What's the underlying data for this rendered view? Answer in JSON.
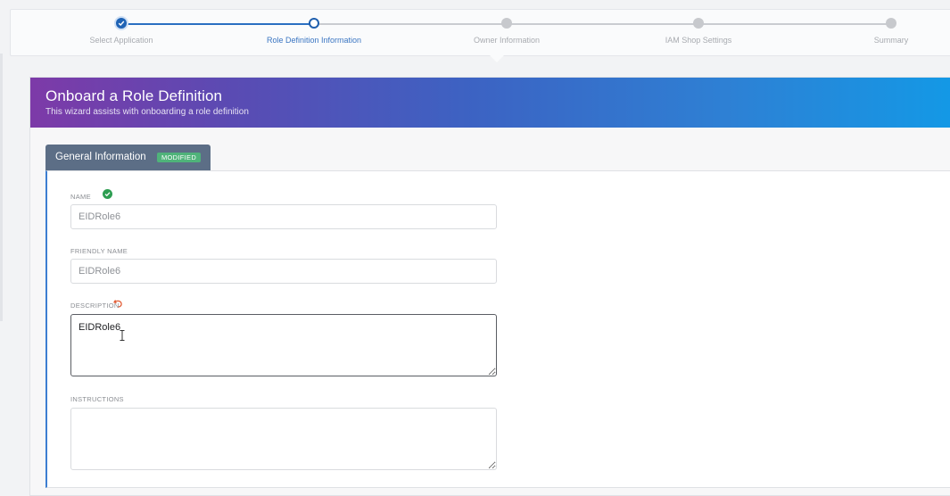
{
  "stepper": {
    "steps": [
      {
        "label": "Select Application",
        "state": "done"
      },
      {
        "label": "Role Definition Information",
        "state": "active"
      },
      {
        "label": "Owner Information",
        "state": "pending"
      },
      {
        "label": "IAM Shop Settings",
        "state": "pending"
      },
      {
        "label": "Summary",
        "state": "pending"
      }
    ]
  },
  "hero": {
    "title": "Onboard a Role Definition",
    "subtitle": "This wizard assists with onboarding a role definition"
  },
  "tab": {
    "label": "General Information",
    "badge": "MODIFIED"
  },
  "form": {
    "name": {
      "label": "NAME",
      "value": "EIDRole6"
    },
    "friendly_name": {
      "label": "FRIENDLY NAME",
      "value": "EIDRole6"
    },
    "description": {
      "label": "DESCRIPTION",
      "value": "EIDRole6"
    },
    "instructions": {
      "label": "INSTRUCTIONS",
      "value": ""
    }
  },
  "colors": {
    "accent": "#1f63b5",
    "badge": "#4fb37a",
    "tab": "#5c6e86",
    "valid": "#2e9e52",
    "undo": "#e0562e"
  },
  "icons": {
    "valid": "check-circle-icon",
    "undo": "undo-icon"
  }
}
